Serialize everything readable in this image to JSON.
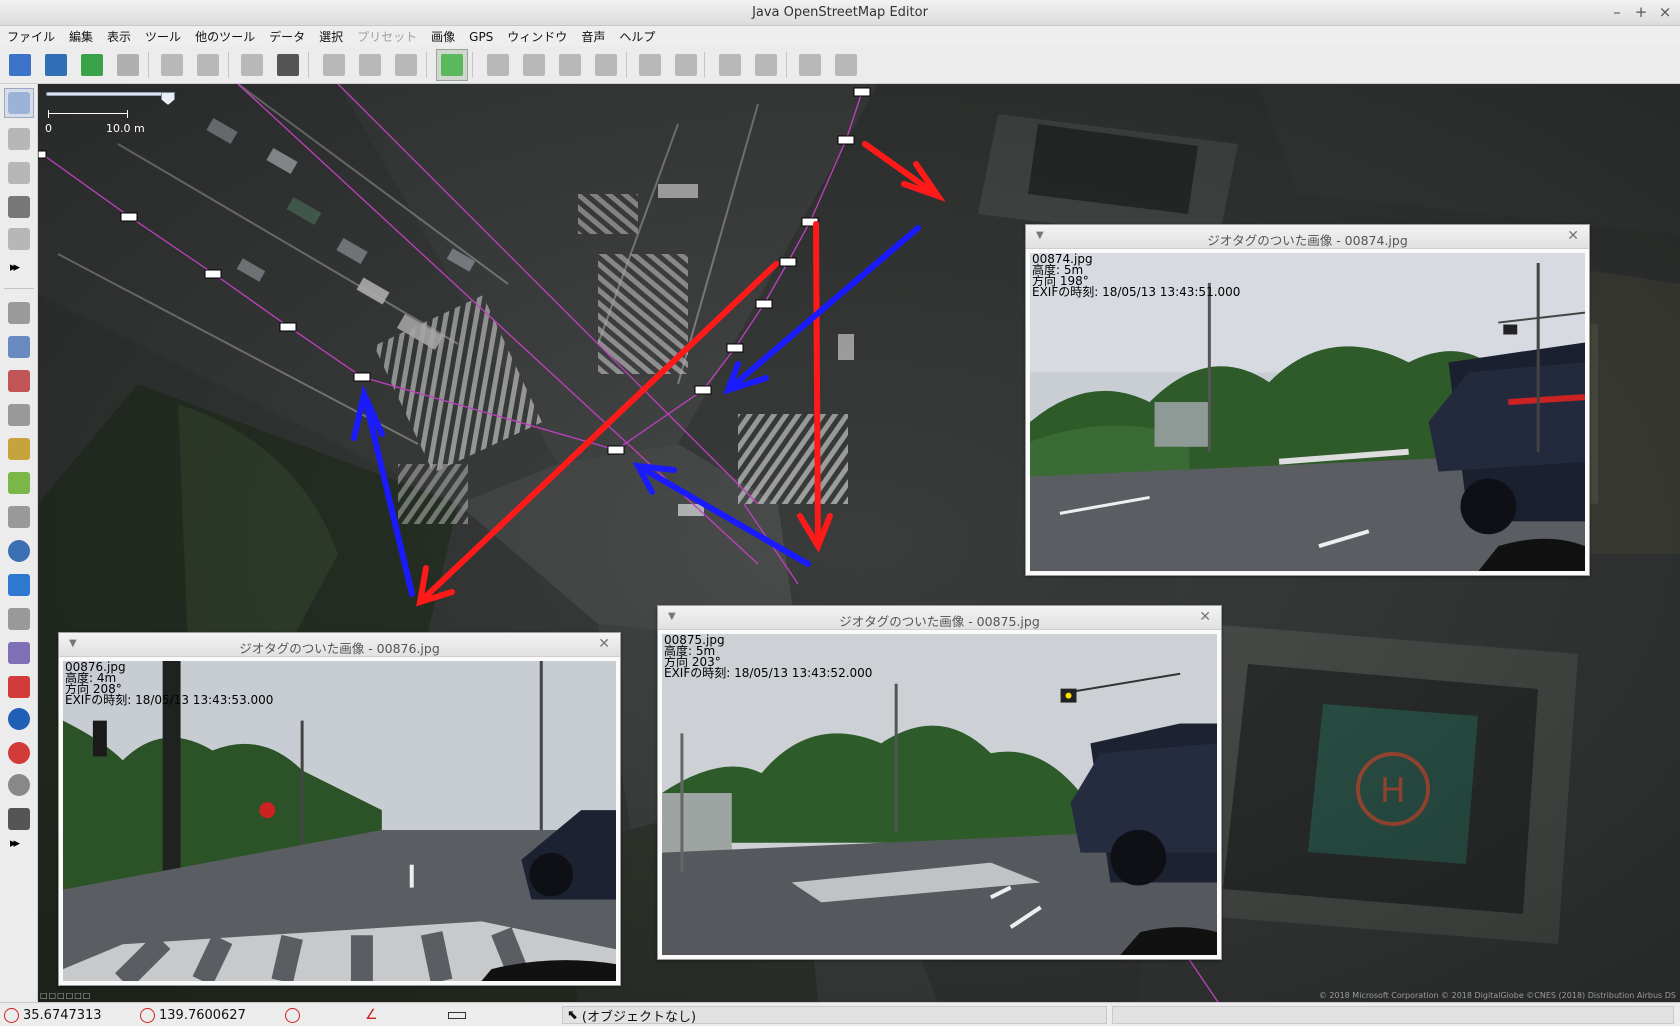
{
  "window": {
    "title": "Java OpenStreetMap Editor",
    "controls": [
      "–",
      "+",
      "×"
    ]
  },
  "menubar": {
    "items": [
      {
        "label": "ファイル",
        "underline_char": "F",
        "disabled": false
      },
      {
        "label": "編集",
        "disabled": false
      },
      {
        "label": "表示",
        "disabled": false
      },
      {
        "label": "ツール",
        "disabled": false
      },
      {
        "label": "他のツール",
        "disabled": false
      },
      {
        "label": "データ",
        "disabled": false
      },
      {
        "label": "選択",
        "disabled": false
      },
      {
        "label": "プリセット",
        "disabled": true
      },
      {
        "label": "画像",
        "disabled": false
      },
      {
        "label": "GPS",
        "disabled": false
      },
      {
        "label": "ウィンドウ",
        "disabled": false
      },
      {
        "label": "音声",
        "disabled": false
      },
      {
        "label": "ヘルプ",
        "disabled": false
      }
    ]
  },
  "toolbar": {
    "buttons": [
      {
        "name": "open-icon",
        "color": "#3b74c7"
      },
      {
        "name": "open-location-icon",
        "color": "#2f6fb5"
      },
      {
        "name": "download-icon",
        "color": "#3aa34a"
      },
      {
        "name": "upload-icon",
        "color": "#b0b0b0"
      },
      {
        "name": "undo-icon",
        "color": "#b8b8b8"
      },
      {
        "name": "redo-icon",
        "color": "#b8b8b8"
      },
      {
        "name": "copy-icon",
        "color": "#b8b8b8"
      },
      {
        "name": "preferences-icon",
        "color": "#555555"
      },
      {
        "name": "split-way-icon",
        "color": "#b8b8b8"
      },
      {
        "name": "combine-way-icon",
        "color": "#b8b8b8"
      },
      {
        "name": "reverse-way-icon",
        "color": "#b8b8b8"
      },
      {
        "name": "wireframe-icon",
        "color": "#5cb85c"
      },
      {
        "name": "preset-door-icon",
        "color": "#b8b8b8"
      },
      {
        "name": "preset-traffic-signals-icon",
        "color": "#b8b8b8"
      },
      {
        "name": "preset-lamp-icon",
        "color": "#b8b8b8"
      },
      {
        "name": "preset-parking-icon",
        "color": "#b8b8b8"
      },
      {
        "name": "preset-car-icon",
        "color": "#b8b8b8"
      },
      {
        "name": "preset-bus-icon",
        "color": "#b8b8b8"
      },
      {
        "name": "preset-caution-icon",
        "color": "#b8b8b8"
      },
      {
        "name": "preset-restaurant-icon",
        "color": "#b8b8b8"
      },
      {
        "name": "preset-castle-icon",
        "color": "#b8b8b8"
      },
      {
        "name": "preset-factory-icon",
        "color": "#b8b8b8"
      }
    ]
  },
  "sidebar": {
    "buttons": [
      {
        "name": "select-mode-icon",
        "color": "#9ab3d6"
      },
      {
        "name": "draw-mode-icon",
        "color": "#b7b7b7"
      },
      {
        "name": "improve-way-icon",
        "color": "#b7b7b7"
      },
      {
        "name": "gpx-import-icon",
        "color": "#777777"
      },
      {
        "name": "layer-icon",
        "color": "#b7b7b7"
      },
      {
        "name": "layers-panel-icon",
        "color": "#9a9a9a"
      },
      {
        "name": "tags-panel-icon",
        "color": "#6a8bc2"
      },
      {
        "name": "relations-panel-icon",
        "color": "#c25555"
      },
      {
        "name": "selection-list-icon",
        "color": "#999999"
      },
      {
        "name": "authors-icon",
        "color": "#c7a33d"
      },
      {
        "name": "changeset-icon",
        "color": "#7ab648"
      },
      {
        "name": "imagery-icon",
        "color": "#999999"
      },
      {
        "name": "conflict-icon",
        "color": "#3d6fb5"
      },
      {
        "name": "validation-icon",
        "color": "#2f78d0"
      },
      {
        "name": "filter-icon",
        "color": "#999999"
      },
      {
        "name": "map-paint-icon",
        "color": "#7f6fb5"
      },
      {
        "name": "notes-icon",
        "color": "#d33a3a"
      },
      {
        "name": "geotagged-image-icon",
        "color": "#1f5fb5"
      },
      {
        "name": "no-entry-icon",
        "color": "#d33a3a"
      },
      {
        "name": "wikipedia-icon",
        "color": "#888888"
      },
      {
        "name": "camera-icon",
        "color": "#555555"
      }
    ],
    "more_label": "▸▸"
  },
  "map": {
    "scale": {
      "min_label": "0",
      "max_label": "10.0 m",
      "zoom_fraction": 0.9
    },
    "attribution": "© 2018 Microsoft Corporation © 2018 DigitalGlobe ©CNES (2018) Distribution Airbus DS",
    "bottom_dots": "□□□□□□"
  },
  "image_windows": [
    {
      "id": "w874",
      "title": "ジオタグのついた画像 - 00874.jpg",
      "filename": "00874.jpg",
      "elevation": "高度: 5m",
      "direction": "方向 198°",
      "exif_time": "EXIFの時刻: 18/05/13 13:43:51.000"
    },
    {
      "id": "w875",
      "title": "ジオタグのついた画像 - 00875.jpg",
      "filename": "00875.jpg",
      "elevation": "高度: 5m",
      "direction": "方向 203°",
      "exif_time": "EXIFの時刻: 18/05/13 13:43:52.000"
    },
    {
      "id": "w876",
      "title": "ジオタグのついた画像 - 00876.jpg",
      "filename": "00876.jpg",
      "elevation": "高度: 4m",
      "direction": "方向 208°",
      "exif_time": "EXIFの時刻: 18/05/13 13:43:53.000"
    }
  ],
  "statusbar": {
    "latitude": "35.6747313",
    "longitude": "139.7600627",
    "heading": "",
    "angle": "",
    "distance": "",
    "selection": "(オブジェクトなし)"
  },
  "colors": {
    "track": "#c040c0",
    "annotation_red": "#ff1a1a",
    "annotation_blue": "#1a1aff",
    "marker_fill": "#ffffff"
  }
}
